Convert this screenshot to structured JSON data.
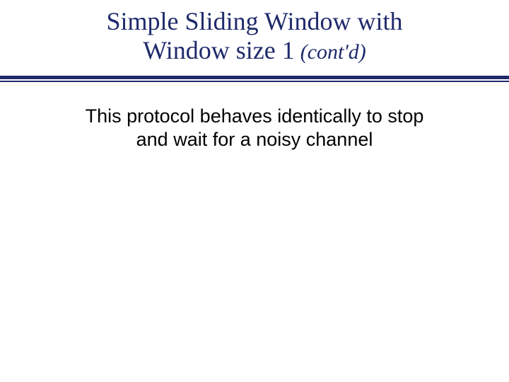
{
  "title": {
    "line1": "Simple Sliding Window with",
    "line2_main": "Window size 1",
    "line2_suffix": "(cont'd)"
  },
  "body": {
    "line1": "This protocol behaves identically to stop",
    "line2": "and wait for a noisy channel"
  },
  "colors": {
    "title": "#1f2a6b",
    "rule": "#1f2a6b",
    "body": "#000000",
    "background": "#ffffff"
  }
}
